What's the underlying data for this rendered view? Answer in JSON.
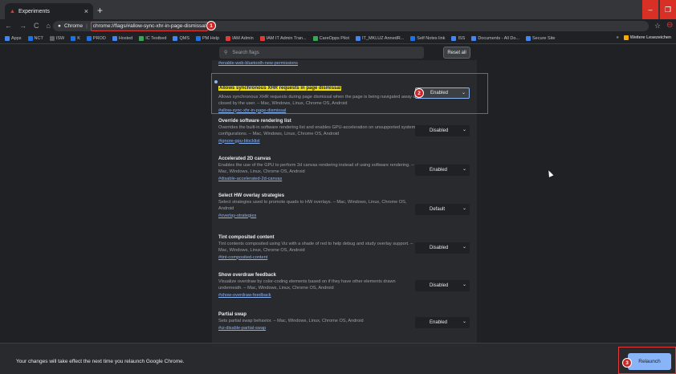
{
  "browser": {
    "tab_title": "Experiments",
    "tab_close": "×",
    "new_tab": "+",
    "min_label": "–",
    "restore_label": "❐",
    "back": "←",
    "forward": "→",
    "reload": "C",
    "home": "⌂",
    "site_label": "Chrome",
    "separator": "|",
    "url": "chrome://flags/#allow-sync-xhr-in-page-dismissal",
    "star": "☆",
    "bookmarks": [
      {
        "label": "Apps",
        "color": "#4285f4"
      },
      {
        "label": "NCT",
        "color": "#1a73e8"
      },
      {
        "label": "ISW",
        "color": "#5f6368"
      },
      {
        "label": "K",
        "color": "#1a73e8"
      },
      {
        "label": "PROD",
        "color": "#1a73e8"
      },
      {
        "label": "Hosted",
        "color": "#4285f4"
      },
      {
        "label": "IC Testbed",
        "color": "#34a853"
      },
      {
        "label": "QMS",
        "color": "#4285f4"
      },
      {
        "label": "PM Help",
        "color": "#1a73e8"
      },
      {
        "label": "IAM Admin",
        "color": "#e53935"
      },
      {
        "label": "IAM IT Admin Tran...",
        "color": "#e53935"
      },
      {
        "label": "CareOpps Pilot",
        "color": "#34a853"
      },
      {
        "label": "IT_MKLUZ AnnedR...",
        "color": "#4285f4"
      },
      {
        "label": "Self Notes link",
        "color": "#1a73e8"
      },
      {
        "label": "ISS",
        "color": "#4285f4"
      },
      {
        "label": "Documents - All Do...",
        "color": "#4285f4"
      },
      {
        "label": "Secure Site",
        "color": "#4285f4"
      }
    ],
    "bookmarks_more": "»",
    "other_bookmarks": "Weitere Lesezeichen"
  },
  "flags_page": {
    "search_placeholder": "Search flags",
    "reset_all": "Reset all",
    "previous_link": "#enable-web-bluetooth-new-permissions",
    "flags": [
      {
        "title": "Allows synchronous XHR requests in page dismissal",
        "description": "Allows synchronous XHR requests during page dismissal when the page is being navigated away or closed by the user. – Mac, Windows, Linux, Chrome OS, Android",
        "link": "#allow-sync-xhr-in-page-dismissal",
        "value": "Enabled"
      },
      {
        "title": "Override software rendering list",
        "description": "Overrides the built-in software rendering list and enables GPU-acceleration on unsupported system configurations. – Mac, Windows, Linux, Chrome OS, Android",
        "link": "#ignore-gpu-blocklist",
        "value": "Disabled"
      },
      {
        "title": "Accelerated 2D canvas",
        "description": "Enables the use of the GPU to perform 2d canvas rendering instead of using software rendering. – Mac, Windows, Linux, Chrome OS, Android",
        "link": "#disable-accelerated-2d-canvas",
        "value": "Enabled"
      },
      {
        "title": "Select HW overlay strategies",
        "description": "Select strategies used to promote quads to HW overlays. – Mac, Windows, Linux, Chrome OS, Android",
        "link": "#overlay-strategies",
        "value": "Default"
      },
      {
        "title": "Tint composited content",
        "description": "Tint contents composited using Viz with a shade of red to help debug and study overlay support. – Mac, Windows, Linux, Chrome OS, Android",
        "link": "#tint-composited-content",
        "value": "Disabled"
      },
      {
        "title": "Show overdraw feedback",
        "description": "Visualize overdraw by color-coding elements based on if they have other elements drawn underneath. – Mac, Windows, Linux, Chrome OS, Android",
        "link": "#show-overdraw-feedback",
        "value": "Disabled"
      },
      {
        "title": "Partial swap",
        "description": "Sets partial swap behavior. – Mac, Windows, Linux, Chrome OS, Android",
        "link": "#ui-disable-partial-swap",
        "value": "Enabled"
      }
    ],
    "chevron": "⌄"
  },
  "annotations": [
    "1",
    "2",
    "3"
  ],
  "footer": {
    "message": "Your changes will take effect the next time you relaunch Google Chrome.",
    "relaunch": "Relaunch"
  },
  "colors": {
    "annotation_red": "#e53935",
    "highlight": "#f2e30b",
    "accent_blue": "#8ab4f8"
  }
}
